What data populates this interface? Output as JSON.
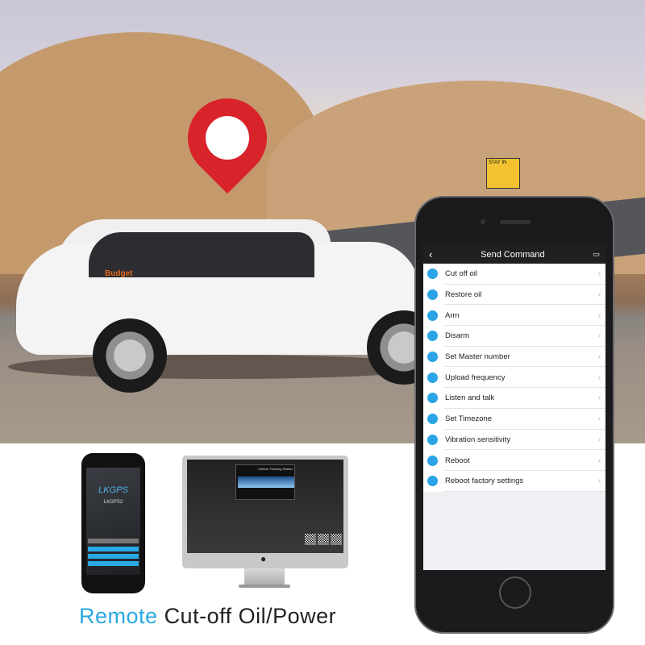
{
  "photo": {
    "car_brand": "Budget",
    "sign_text": "STAY IN"
  },
  "app": {
    "title": "Send Command",
    "back_icon": "chevron-left-icon",
    "message_icon": "chat-icon",
    "accent": "#2aa4e6",
    "commands": [
      {
        "label": "Cut off oil",
        "icon": "oil-off-icon"
      },
      {
        "label": "Restore oil",
        "icon": "oil-restore-icon"
      },
      {
        "label": "Arm",
        "icon": "lock-icon"
      },
      {
        "label": "Disarm",
        "icon": "unlock-icon"
      },
      {
        "label": "Set Master number",
        "icon": "phone-icon"
      },
      {
        "label": "Upload frequency",
        "icon": "upload-icon"
      },
      {
        "label": "Listen and talk",
        "icon": "call-icon"
      },
      {
        "label": "Set Timezone",
        "icon": "moon-icon"
      },
      {
        "label": "Vibration sensitivity",
        "icon": "vibration-icon"
      },
      {
        "label": "Reboot",
        "icon": "monitor-icon"
      },
      {
        "label": "Reboot factory settings",
        "icon": "reset-icon"
      }
    ]
  },
  "small_phone": {
    "logo": "LKGPS",
    "name": "LKGPS2"
  },
  "monitor": {
    "title": "Vehicle Tracking Station"
  },
  "caption": {
    "highlight": "Remote",
    "rest": "Cut-off Oil/Power",
    "highlight_color": "#2aa8e0"
  }
}
